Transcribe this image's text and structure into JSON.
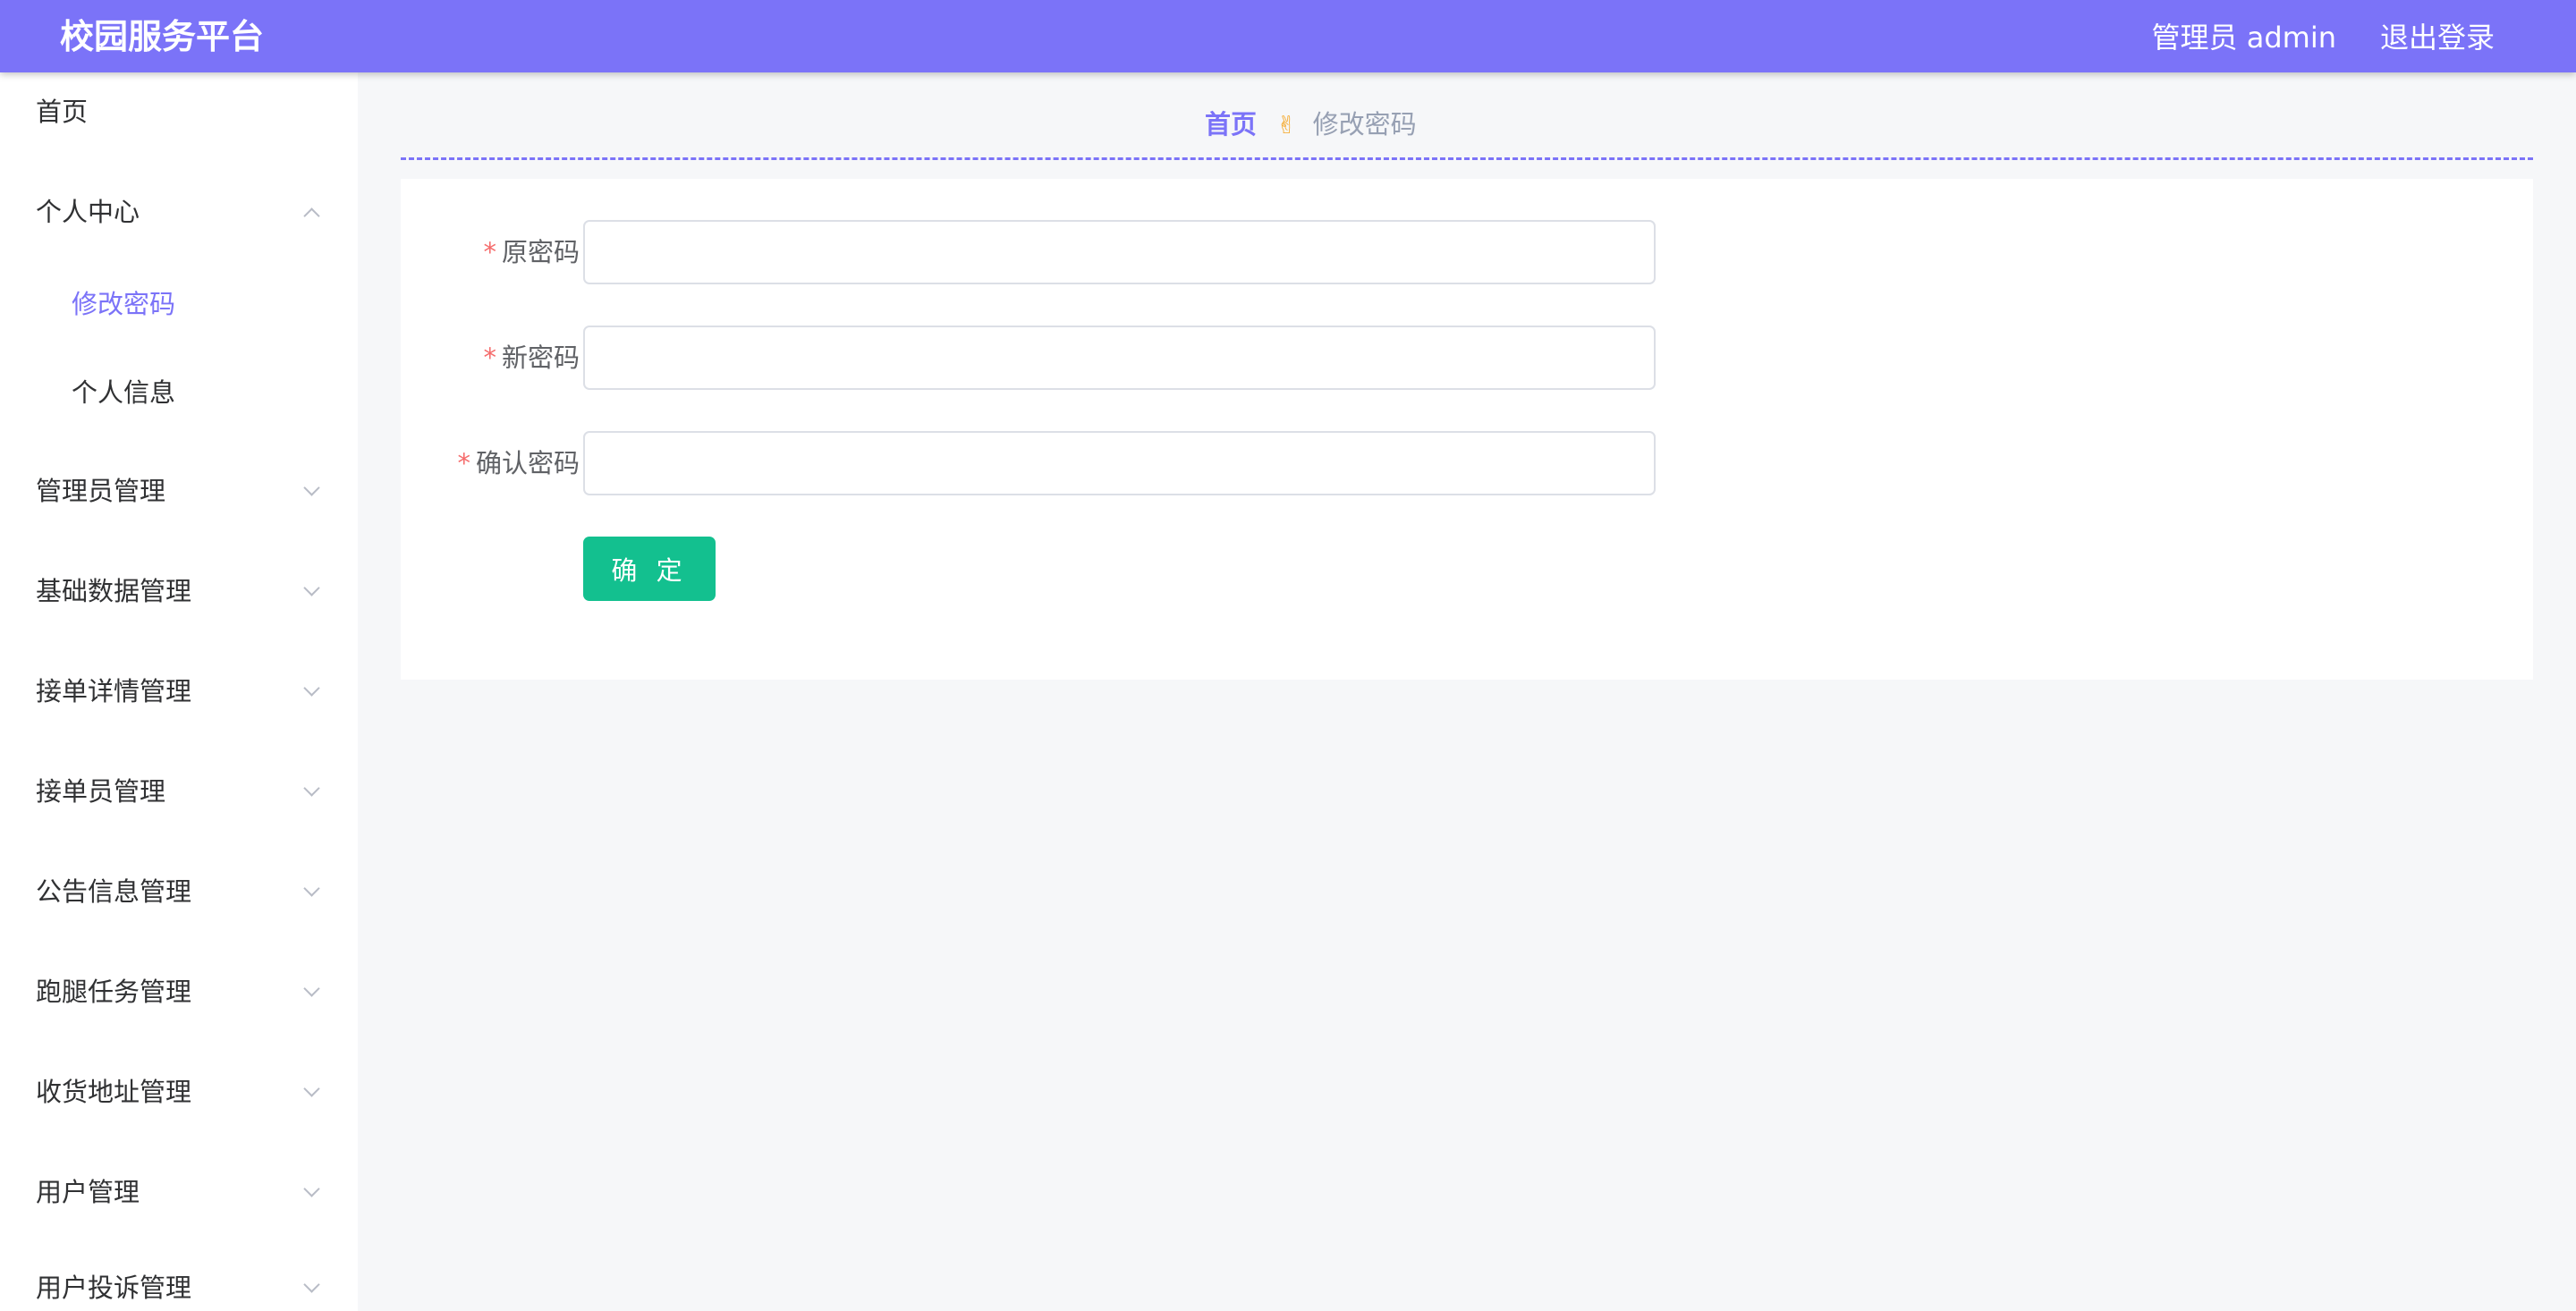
{
  "header": {
    "title": "校园服务平台",
    "user": "管理员 admin",
    "logout": "退出登录",
    "bg_color": "#7b73f8"
  },
  "sidebar": {
    "items": [
      {
        "label": "首页",
        "level": 1,
        "expandable": false
      },
      {
        "label": "个人中心",
        "level": 1,
        "expandable": true,
        "expanded": true
      },
      {
        "label": "修改密码",
        "level": 2,
        "active": true
      },
      {
        "label": "个人信息",
        "level": 2
      },
      {
        "label": "管理员管理",
        "level": 1,
        "expandable": true
      },
      {
        "label": "基础数据管理",
        "level": 1,
        "expandable": true
      },
      {
        "label": "接单详情管理",
        "level": 1,
        "expandable": true
      },
      {
        "label": "接单员管理",
        "level": 1,
        "expandable": true
      },
      {
        "label": "公告信息管理",
        "level": 1,
        "expandable": true
      },
      {
        "label": "跑腿任务管理",
        "level": 1,
        "expandable": true
      },
      {
        "label": "收货地址管理",
        "level": 1,
        "expandable": true
      },
      {
        "label": "用户管理",
        "level": 1,
        "expandable": true
      },
      {
        "label": "用户投诉管理",
        "level": 1,
        "expandable": true
      }
    ]
  },
  "breadcrumb": {
    "home": "首页",
    "separator_icon": "victory-hand-icon",
    "separator": "✌",
    "current": "修改密码"
  },
  "form": {
    "required_mark": "*",
    "fields": [
      {
        "label": "原密码",
        "value": "",
        "placeholder": ""
      },
      {
        "label": "新密码",
        "value": "",
        "placeholder": ""
      },
      {
        "label": "确认密码",
        "value": "",
        "placeholder": ""
      }
    ],
    "submit_label": "确 定",
    "submit_color": "#13c08f"
  }
}
